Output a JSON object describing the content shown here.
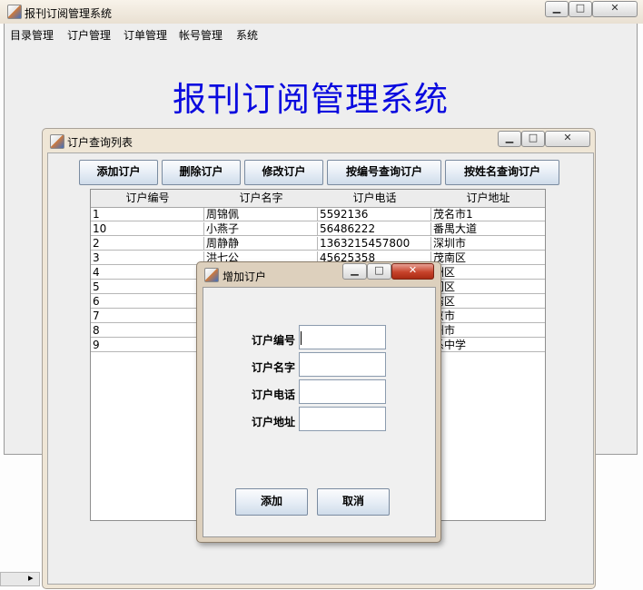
{
  "main_window": {
    "title": "报刊订阅管理系统",
    "controls": [
      "▁",
      "□",
      "✕"
    ]
  },
  "menu": [
    {
      "label": "目录管理"
    },
    {
      "label": "订户管理"
    },
    {
      "label": "订单管理"
    },
    {
      "label": "帐号管理"
    },
    {
      "label": "系统"
    }
  ],
  "heading": "报刊订阅管理系统",
  "list_window": {
    "title": "订户查询列表",
    "controls": [
      "▁",
      "□",
      "✕"
    ],
    "toolbar": [
      {
        "label": "添加订户"
      },
      {
        "label": "删除订户"
      },
      {
        "label": "修改订户"
      },
      {
        "label": "按编号查询订户"
      },
      {
        "label": "按姓名查询订户"
      }
    ],
    "table": {
      "columns": [
        "订户编号",
        "订户名字",
        "订户电话",
        "订户地址"
      ],
      "rows": [
        [
          "1",
          "周锦佩",
          "5592136",
          "茂名市1"
        ],
        [
          "10",
          "小燕子",
          "56486222",
          "番禺大道"
        ],
        [
          "2",
          "周静静",
          "1363215457800",
          "深圳市"
        ],
        [
          "3",
          "洪七公",
          "45625358",
          "茂南区"
        ],
        [
          "4",
          "",
          "",
          "洲区"
        ],
        [
          "5",
          "",
          "",
          "门区"
        ],
        [
          "6",
          "",
          "",
          "湾区"
        ],
        [
          "7",
          "",
          "",
          "京市"
        ],
        [
          "8",
          "",
          "",
          "州市"
        ],
        [
          "9",
          "",
          "",
          "系中学"
        ]
      ]
    }
  },
  "dialog": {
    "title": "增加订户",
    "controls": [
      "▁",
      "□",
      "✕"
    ],
    "fields": [
      {
        "label": "订户编号",
        "value": ""
      },
      {
        "label": "订户名字",
        "value": ""
      },
      {
        "label": "订户电话",
        "value": ""
      },
      {
        "label": "订户地址",
        "value": ""
      }
    ],
    "buttons": {
      "add": "添加",
      "cancel": "取消"
    }
  },
  "scrollbar": {
    "arrow": "▸"
  }
}
